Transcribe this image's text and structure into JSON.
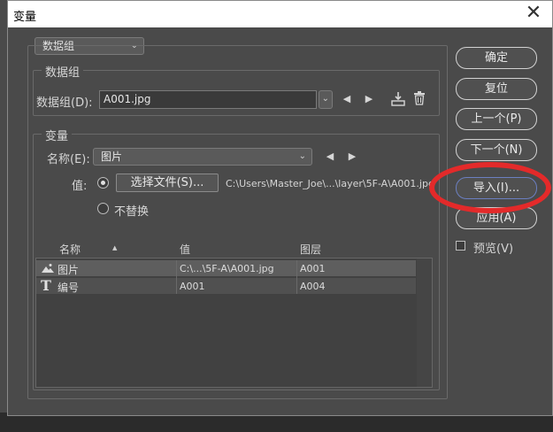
{
  "dialog": {
    "title": "变量",
    "close_symbol": "✕"
  },
  "top_dropdown": {
    "value": "数据组"
  },
  "dataset_group": {
    "title": "数据组",
    "label": "数据组(D):",
    "value": "A001.jpg",
    "icons": [
      "arrow-left-icon",
      "arrow-right-icon",
      "import-dataset-icon",
      "trash-icon"
    ]
  },
  "variable_group": {
    "title": "变量",
    "name_label": "名称(E):",
    "name_value": "图片",
    "value_label": "值:",
    "choose_file_label": "选择文件(S)...",
    "file_path": "C:\\Users\\Master_Joe\\...\\layer\\5F-A\\A001.jpg",
    "no_replace_label": "不替换"
  },
  "table": {
    "headers": [
      "名称",
      "值",
      "图层"
    ],
    "sort_arrow": "▲",
    "rows": [
      {
        "icon": "image-icon",
        "name": "图片",
        "value": "C:\\...\\5F-A\\A001.jpg",
        "layer": "A001",
        "selected": true
      },
      {
        "icon": "text-icon",
        "name": "编号",
        "value": "A001",
        "layer": "A004",
        "selected": false
      }
    ]
  },
  "buttons": {
    "ok": "确定",
    "reset": "复位",
    "prev": "上一个(P)",
    "next": "下一个(N)",
    "import": "导入(I)...",
    "apply": "应用(A)",
    "preview": "预览(V)"
  },
  "colors": {
    "dialog_bg": "#4a4a4a",
    "highlight": "#e32a2a",
    "focus": "#6b7fc1"
  }
}
